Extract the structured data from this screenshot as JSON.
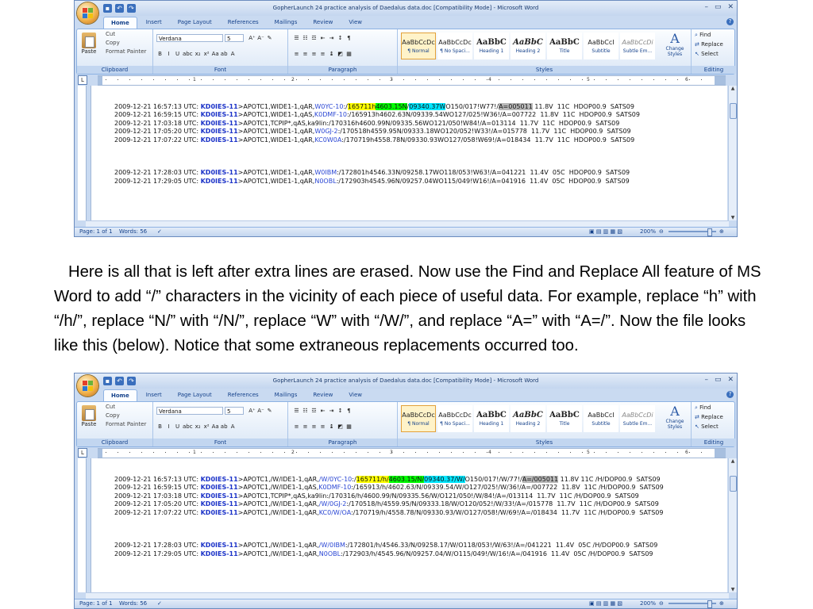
{
  "windows": [
    {
      "title": "GopherLaunch 24 practice analysis of Daedalus data.doc [Compatibility Mode] - Microsoft Word",
      "tabs": [
        "Home",
        "Insert",
        "Page Layout",
        "References",
        "Mailings",
        "Review",
        "View"
      ],
      "active_tab": "Home",
      "clipboard": {
        "paste": "Paste",
        "cut": "Cut",
        "copy": "Copy",
        "format_painter": "Format Painter",
        "label": "Clipboard"
      },
      "font": {
        "name": "Verdana",
        "size": "5",
        "label": "Font"
      },
      "paragraph_label": "Paragraph",
      "styles": [
        {
          "sample": "AaBbCcDc",
          "name": "¶ Normal"
        },
        {
          "sample": "AaBbCcDc",
          "name": "¶ No Spaci..."
        },
        {
          "sample": "AaBbC",
          "name": "Heading 1"
        },
        {
          "sample": "AaBbC",
          "name": "Heading 2"
        },
        {
          "sample": "AaBbC",
          "name": "Title"
        },
        {
          "sample": "AaBbCcI",
          "name": "Subtitle"
        },
        {
          "sample": "AaBbCcDi",
          "name": "Subtle Em..."
        }
      ],
      "styles_label": "Styles",
      "change_styles": "Change Styles",
      "editing": {
        "find": "Find",
        "replace": "Replace",
        "select": "Select",
        "label": "Editing"
      },
      "ruler_numbers": [
        "1",
        "2",
        "3",
        "4",
        "5",
        "6"
      ],
      "lines": [
        [
          {
            "t": "2009-12-21 16:57:13 UTC: "
          },
          {
            "t": "KD0IES-11",
            "c": "call"
          },
          {
            "t": ">APOTC1,WIDE1-1,qAR,"
          },
          {
            "t": "W0YC-10",
            "c": "blue"
          },
          {
            "t": ":/"
          },
          {
            "t": "165711h",
            "c": "hl-y"
          },
          {
            "t": "4603.15N",
            "c": "hl-g"
          },
          {
            "t": "/"
          },
          {
            "t": "09340.37W",
            "c": "hl-c"
          },
          {
            "t": "O150/017!W77!/"
          },
          {
            "t": "A=005011",
            "c": "hl-gr"
          },
          {
            "t": " 11.8V  11C  HDOP00.9  SATS09"
          }
        ],
        [
          {
            "t": "2009-12-21 16:59:15 UTC: "
          },
          {
            "t": "KD0IES-11",
            "c": "call"
          },
          {
            "t": ">APOTC1,WIDE1-1,qAS,"
          },
          {
            "t": "K0DMF-10",
            "c": "blue"
          },
          {
            "t": ":/165913h4602.63N/09339.54WO127/025!W36!/A=007722  11.8V  11C  HDOP00.9  SATS09"
          }
        ],
        [
          {
            "t": "2009-12-21 17:03:18 UTC: "
          },
          {
            "t": "KD0IES-11",
            "c": "call"
          },
          {
            "t": ">APOTC1,TCPIP*,qAS,ka9lin:/170316h4600.99N/09335.56WO121/050!W84!/A=013114  11.7V  11C  HDOP00.9  SATS09"
          }
        ],
        [
          {
            "t": "2009-12-21 17:05:20 UTC: "
          },
          {
            "t": "KD0IES-11",
            "c": "call"
          },
          {
            "t": ">APOTC1,WIDE1-1,qAR,"
          },
          {
            "t": "W0GJ-2",
            "c": "blue"
          },
          {
            "t": ":/170518h4559.95N/09333.18WO120/052!W33!/A=015778  11.7V  11C  HDOP00.9  SATS09"
          }
        ],
        [
          {
            "t": "2009-12-21 17:07:22 UTC: "
          },
          {
            "t": "KD0IES-11",
            "c": "call"
          },
          {
            "t": ">APOTC1,WIDE1-1,qAR,"
          },
          {
            "t": "KC0W0A",
            "c": "blue"
          },
          {
            "t": ":/170719h4558.78N/09330.93WO127/058!W69!/A=018434  11.7V  11C  HDOP00.9  SATS09"
          }
        ],
        [],
        [],
        [],
        [
          {
            "t": "2009-12-21 17:28:03 UTC: "
          },
          {
            "t": "KD0IES-11",
            "c": "call"
          },
          {
            "t": ">APOTC1,WIDE1-1,qAR,"
          },
          {
            "t": "W0IBM",
            "c": "blue"
          },
          {
            "t": ":/172801h4546.33N/09258.17WO118/053!W63!/A=041221  11.4V  05C  HDOP00.9  SATS09"
          }
        ],
        [
          {
            "t": "2009-12-21 17:29:05 UTC: "
          },
          {
            "t": "KD0IES-11",
            "c": "call"
          },
          {
            "t": ">APOTC1,WIDE1-1,qAR,"
          },
          {
            "t": "N0OBL",
            "c": "blue"
          },
          {
            "t": ":/172903h4545.96N/09257.04WO115/049!W16!/A=041916  11.4V  05C  HDOP00.9  SATS09"
          }
        ]
      ],
      "status": {
        "page": "Page: 1 of 1",
        "words": "Words: 56",
        "zoom": "200%",
        "zoom_level": 0.85
      }
    },
    {
      "title": "GopherLaunch 24 practice analysis of Daedalus data.doc [Compatibility Mode] - Microsoft Word",
      "tabs": [
        "Home",
        "Insert",
        "Page Layout",
        "References",
        "Mailings",
        "Review",
        "View"
      ],
      "active_tab": "Home",
      "clipboard": {
        "paste": "Paste",
        "cut": "Cut",
        "copy": "Copy",
        "format_painter": "Format Painter",
        "label": "Clipboard"
      },
      "font": {
        "name": "Verdana",
        "size": "5",
        "label": "Font"
      },
      "paragraph_label": "Paragraph",
      "styles": [
        {
          "sample": "AaBbCcDc",
          "name": "¶ Normal"
        },
        {
          "sample": "AaBbCcDc",
          "name": "¶ No Spaci..."
        },
        {
          "sample": "AaBbC",
          "name": "Heading 1"
        },
        {
          "sample": "AaBbC",
          "name": "Heading 2"
        },
        {
          "sample": "AaBbC",
          "name": "Title"
        },
        {
          "sample": "AaBbCcI",
          "name": "Subtitle"
        },
        {
          "sample": "AaBbCcDi",
          "name": "Subtle Em..."
        }
      ],
      "styles_label": "Styles",
      "change_styles": "Change Styles",
      "editing": {
        "find": "Find",
        "replace": "Replace",
        "select": "Select",
        "label": "Editing"
      },
      "ruler_numbers": [
        "1",
        "2",
        "3",
        "4",
        "5",
        "6"
      ],
      "lines": [
        [
          {
            "t": "2009-12-21 16:57:13 UTC: "
          },
          {
            "t": "KD0IES-11",
            "c": "call"
          },
          {
            "t": ">APOTC1,/W/IDE1-1,qAR,"
          },
          {
            "t": "/W/0YC-10",
            "c": "blue"
          },
          {
            "t": ":/"
          },
          {
            "t": "165711/h/",
            "c": "hl-y"
          },
          {
            "t": "4603.15/N/",
            "c": "hl-g"
          },
          {
            "t": "09340.37/W/",
            "c": "hl-c"
          },
          {
            "t": "O150/017!/W/77!/"
          },
          {
            "t": "A=/005011",
            "c": "hl-gr"
          },
          {
            "t": " 11.8V 11C /H/DOP00.9  SATS09"
          }
        ],
        [
          {
            "t": "2009-12-21 16:59:15 UTC: "
          },
          {
            "t": "KD0IES-11",
            "c": "call"
          },
          {
            "t": ">APOTC1,/W/IDE1-1,qAS,"
          },
          {
            "t": "K0DMF-10",
            "c": "blue"
          },
          {
            "t": ":/165913/h/4602.63/N/09339.54/W/O127/025!/W/36!/A=/007722  11.8V  11C /H/DOP00.9  SATS09"
          }
        ],
        [
          {
            "t": "2009-12-21 17:03:18 UTC: "
          },
          {
            "t": "KD0IES-11",
            "c": "call"
          },
          {
            "t": ">APOTC1,TCPIP*,qAS,ka9lin:/170316/h/4600.99/N/09335.56/W/O121/050!/W/84!/A=/013114  11.7V  11C /H/DOP00.9  SATS09"
          }
        ],
        [
          {
            "t": "2009-12-21 17:05:20 UTC: "
          },
          {
            "t": "KD0IES-11",
            "c": "call"
          },
          {
            "t": ">APOTC1,/W/IDE1-1,qAR,"
          },
          {
            "t": "/W/0GJ-2",
            "c": "blue"
          },
          {
            "t": ":/170518/h/4559.95/N/09333.18/W/O120/052!/W/33!/A=/015778  11.7V  11C /H/DOP00.9  SATS09"
          }
        ],
        [
          {
            "t": "2009-12-21 17:07:22 UTC: "
          },
          {
            "t": "KD0IES-11",
            "c": "call"
          },
          {
            "t": ">APOTC1,/W/IDE1-1,qAR,"
          },
          {
            "t": "KC0/W/OA",
            "c": "blue"
          },
          {
            "t": ":/170719/h/4558.78/N/09330.93/W/O127/058!/W/69!/A=/018434  11.7V  11C /H/DOP00.9  SATS09"
          }
        ],
        [],
        [],
        [],
        [
          {
            "t": "2009-12-21 17:28:03 UTC: "
          },
          {
            "t": "KD0IES-11",
            "c": "call"
          },
          {
            "t": ">APOTC1,/W/IDE1-1,qAR,"
          },
          {
            "t": "/W/0IBM",
            "c": "blue"
          },
          {
            "t": ":/172801/h/4546.33/N/09258.17/W/O118/053!/W/63!/A=/041221  11.4V  05C /H/DOP00.9  SATS09"
          }
        ],
        [
          {
            "t": "2009-12-21 17:29:05 UTC: "
          },
          {
            "t": "KD0IES-11",
            "c": "call"
          },
          {
            "t": ">APOTC1,/W/IDE1-1,qAR,"
          },
          {
            "t": "N0OBL",
            "c": "blue"
          },
          {
            "t": ":/172903/h/4545.96/N/09257.04/W/O115/049!/W/16!/A=/041916  11.4V  05C /H/DOP00.9  SATS09"
          }
        ]
      ],
      "status": {
        "page": "Page: 1 of 1",
        "words": "Words: 56",
        "zoom": "200%",
        "zoom_level": 0.85
      }
    }
  ],
  "caption": "Here is all that is left after extra lines are erased.  Now use the Find and Replace All feature of MS Word to add “/” characters in the vicinity of each piece of useful data.  For example, replace “h” with “/h/”, replace “N/” with “/N/”, replace “W” with “/W/”, and replace “A=” with “A=/”.  Now the file looks like this (below).  Notice that some extraneous replacements occurred too."
}
